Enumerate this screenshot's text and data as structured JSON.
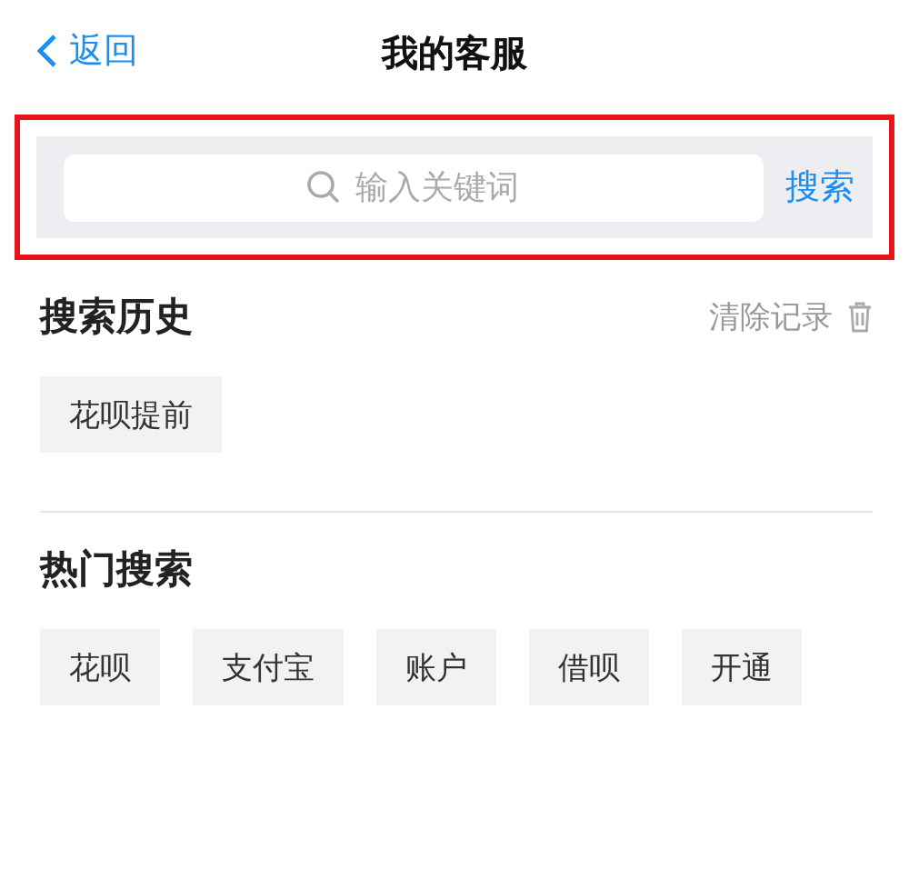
{
  "nav": {
    "back": "返回",
    "title": "我的客服"
  },
  "search": {
    "placeholder": "输入关键词",
    "button": "搜索",
    "highlighted": true
  },
  "history": {
    "title": "搜索历史",
    "clear": "清除记录",
    "items": [
      "花呗提前"
    ]
  },
  "hot": {
    "title": "热门搜索",
    "items": [
      "花呗",
      "支付宝",
      "账户",
      "借呗",
      "开通"
    ]
  }
}
